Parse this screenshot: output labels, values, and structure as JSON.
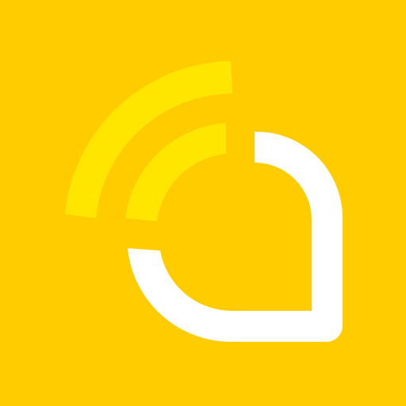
{
  "icon": {
    "name": "app-logo-icon",
    "background_color": "#FFCC00",
    "arc_color": "#FFE600",
    "bubble_color": "#FFFFFF"
  }
}
